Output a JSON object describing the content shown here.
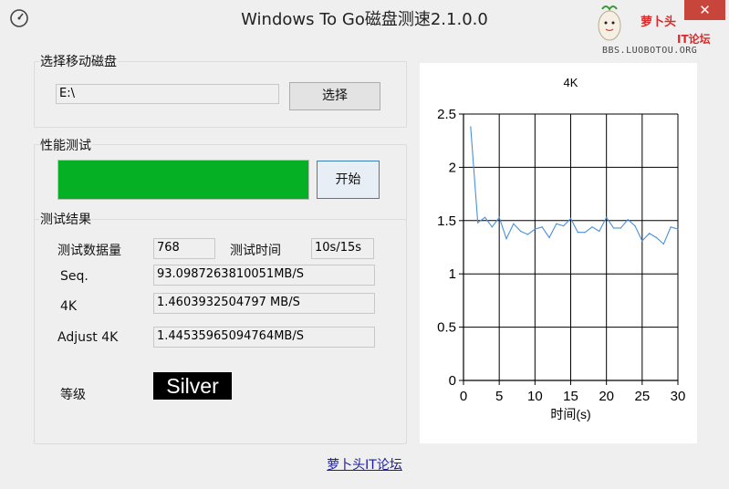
{
  "window": {
    "title": "Windows To Go磁盘测速2.1.0.0",
    "close_glyph": "✕",
    "app_icon": "speedometer-icon"
  },
  "brand": {
    "name": "萝卜头",
    "it": "IT论坛",
    "url": "BBS.LUOBOTOU.ORG",
    "mascot_icon": "radish-mascot-icon"
  },
  "drive_group": {
    "label": "选择移动磁盘",
    "path_value": "E:\\",
    "select_label": "选择"
  },
  "perf_group": {
    "label": "性能测试",
    "progress": 1.0,
    "progress_color": "#06b025",
    "start_label": "开始"
  },
  "results_group": {
    "label": "测试结果",
    "data_amount_label": "测试数据量",
    "data_amount_value": "768",
    "test_time_label": "测试时间",
    "test_time_value": "10s/15s",
    "seq_label": "Seq.",
    "seq_value": "93.0987263810051MB/S",
    "k4_label": "4K",
    "k4_value": "1.4603932504797 MB/S",
    "adjust_label": "Adjust 4K",
    "adjust_value": "1.44535965094764MB/S",
    "grade_label": "等级",
    "grade_value": "Silver"
  },
  "footer": {
    "link_text": "萝卜头IT论坛"
  },
  "chart_data": {
    "type": "line",
    "title": "4K",
    "xlabel": "时间(s)",
    "ylabel": "",
    "xlim": [
      0,
      30
    ],
    "ylim": [
      0,
      2.5
    ],
    "x_ticks": [
      0,
      5,
      10,
      15,
      20,
      25,
      30
    ],
    "y_ticks": [
      0,
      0.5,
      1,
      1.5,
      2,
      2.5
    ],
    "x_tick_labels": [
      "0",
      "5",
      "10",
      "15",
      "20",
      "25",
      "30"
    ],
    "y_tick_labels": [
      "0",
      "0.5",
      "1",
      "1.5",
      "2",
      "2.5"
    ],
    "grid": true,
    "line_color": "#4a90d9",
    "series": [
      {
        "x": [
          1,
          2,
          3,
          4,
          5,
          6,
          7,
          8,
          9,
          10,
          11,
          12,
          13,
          14,
          15,
          16,
          17,
          18,
          19,
          20,
          21,
          22,
          23,
          24,
          25,
          26,
          27,
          28,
          29,
          30
        ],
        "values": [
          2.38,
          1.48,
          1.53,
          1.44,
          1.53,
          1.33,
          1.47,
          1.4,
          1.37,
          1.42,
          1.44,
          1.34,
          1.47,
          1.45,
          1.52,
          1.39,
          1.39,
          1.44,
          1.4,
          1.53,
          1.43,
          1.43,
          1.51,
          1.45,
          1.31,
          1.38,
          1.34,
          1.28,
          1.44,
          1.42
        ]
      }
    ]
  }
}
